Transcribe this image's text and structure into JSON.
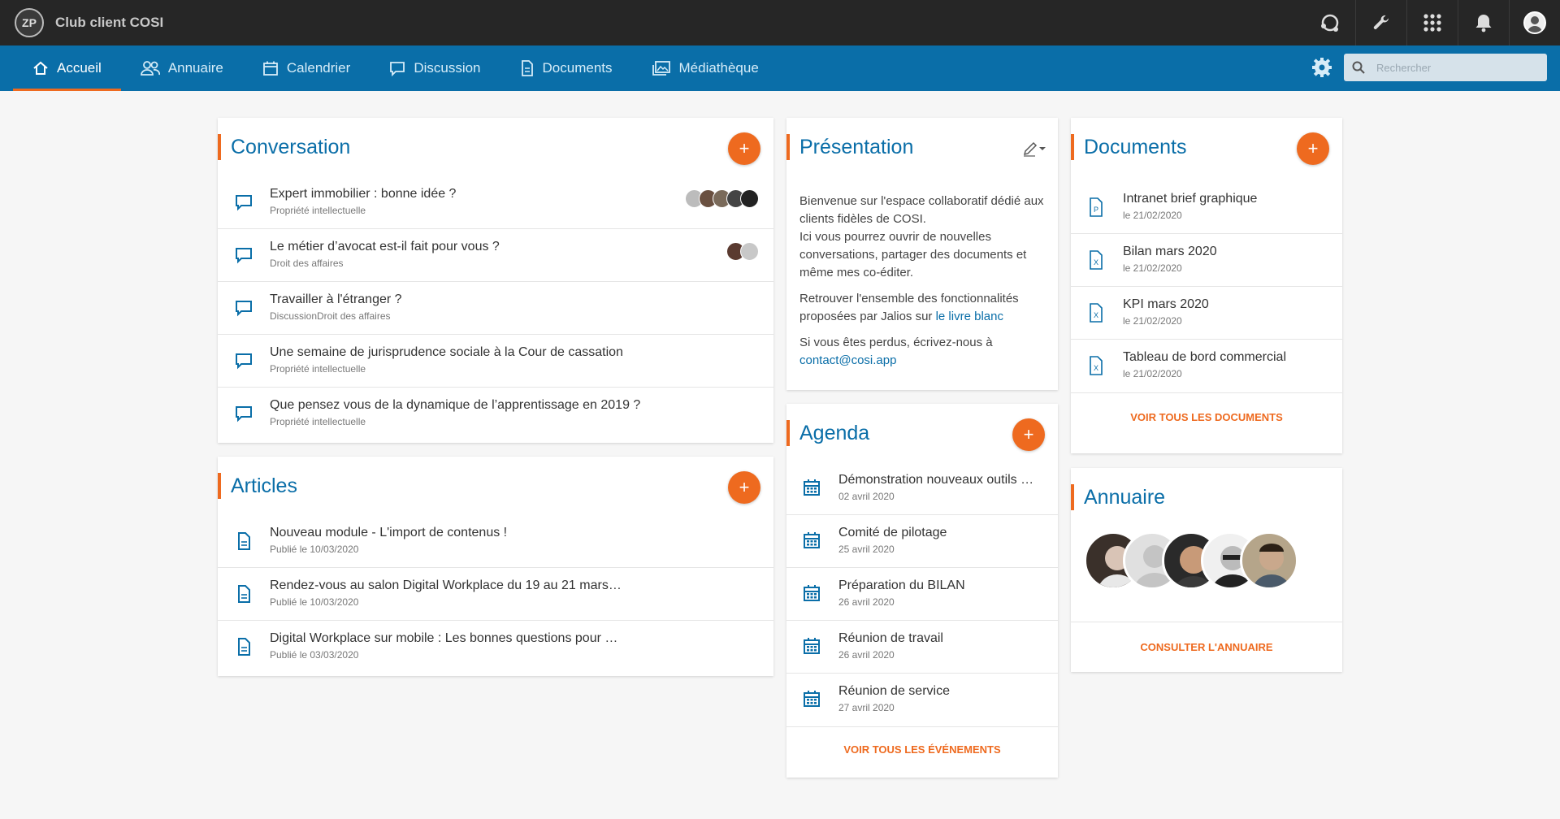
{
  "app": {
    "title": "Club client COSI",
    "logo_text": "ZP"
  },
  "topbar": {
    "icons": [
      "support-icon",
      "wrench-icon",
      "apps-grid-icon",
      "bell-icon",
      "user-avatar"
    ]
  },
  "nav": {
    "items": [
      {
        "label": "Accueil",
        "icon": "home-icon",
        "active": true
      },
      {
        "label": "Annuaire",
        "icon": "people-icon"
      },
      {
        "label": "Calendrier",
        "icon": "calendar-icon"
      },
      {
        "label": "Discussion",
        "icon": "chat-icon"
      },
      {
        "label": "Documents",
        "icon": "document-icon"
      },
      {
        "label": "Médiathèque",
        "icon": "media-icon"
      }
    ],
    "search_placeholder": "Rechercher"
  },
  "conversation": {
    "title": "Conversation",
    "add_label": "+",
    "items": [
      {
        "title": "Expert immobilier : bonne idée ?",
        "subtitle": "Propriété intellectuelle"
      },
      {
        "title": "Le métier d’avocat est-il fait pour vous ?",
        "subtitle": "Droit des affaires"
      },
      {
        "title": "Travailler à l'étranger ?",
        "subtitle": "DiscussionDroit des affaires"
      },
      {
        "title": "Une semaine de jurisprudence sociale à la Cour de cassation",
        "subtitle": "Propriété intellectuelle"
      },
      {
        "title": "Que pensez vous de la dynamique de l’apprentissage en 2019 ?",
        "subtitle": "Propriété intellectuelle"
      }
    ]
  },
  "articles": {
    "title": "Articles",
    "add_label": "+",
    "items": [
      {
        "title": "Nouveau module - L'import de contenus !",
        "subtitle": "Publié le 10/03/2020"
      },
      {
        "title": "Rendez-vous au salon Digital Workplace du 19 au 21 mars…",
        "subtitle": "Publié le 10/03/2020"
      },
      {
        "title": "Digital Workplace sur mobile : Les bonnes questions pour …",
        "subtitle": "Publié le 03/03/2020"
      }
    ]
  },
  "presentation": {
    "title": "Présentation",
    "p1": "Bienvenue sur l'espace collaboratif dédié aux clients fidèles de COSI.",
    "p1b": "Ici vous pourrez ouvrir de nouvelles conversations, partager des documents et même mes co-éditer.",
    "p2_text": "Retrouver l'ensemble des fonctionnalités proposées par Jalios sur ",
    "p2_link": "le livre blanc",
    "p3_text": "Si vous êtes perdus, écrivez-nous à ",
    "p3_link": "contact@cosi.app"
  },
  "agenda": {
    "title": "Agenda",
    "add_label": "+",
    "items": [
      {
        "title": "Démonstration nouveaux outils …",
        "subtitle": "02 avril 2020"
      },
      {
        "title": "Comité de pilotage",
        "subtitle": "25 avril 2020"
      },
      {
        "title": "Préparation du BILAN",
        "subtitle": "26 avril 2020"
      },
      {
        "title": "Réunion de travail",
        "subtitle": "26 avril 2020"
      },
      {
        "title": "Réunion de service",
        "subtitle": "27 avril 2020"
      }
    ],
    "footer": "VOIR TOUS LES ÉVÉNEMENTS"
  },
  "documents": {
    "title": "Documents",
    "add_label": "+",
    "items": [
      {
        "title": "Intranet brief graphique",
        "subtitle": "le 21/02/2020",
        "type": "P"
      },
      {
        "title": "Bilan mars 2020",
        "subtitle": "le 21/02/2020",
        "type": "X"
      },
      {
        "title": "KPI mars 2020",
        "subtitle": "le 21/02/2020",
        "type": "X"
      },
      {
        "title": "Tableau de bord commercial",
        "subtitle": "le 21/02/2020",
        "type": "X"
      }
    ],
    "footer": "VOIR TOUS LES DOCUMENTS"
  },
  "annuaire": {
    "title": "Annuaire",
    "footer": "CONSULTER L'ANNUAIRE"
  },
  "colors": {
    "primary": "#0a6ea8",
    "accent": "#ee6a1f",
    "topbar": "#262626"
  }
}
